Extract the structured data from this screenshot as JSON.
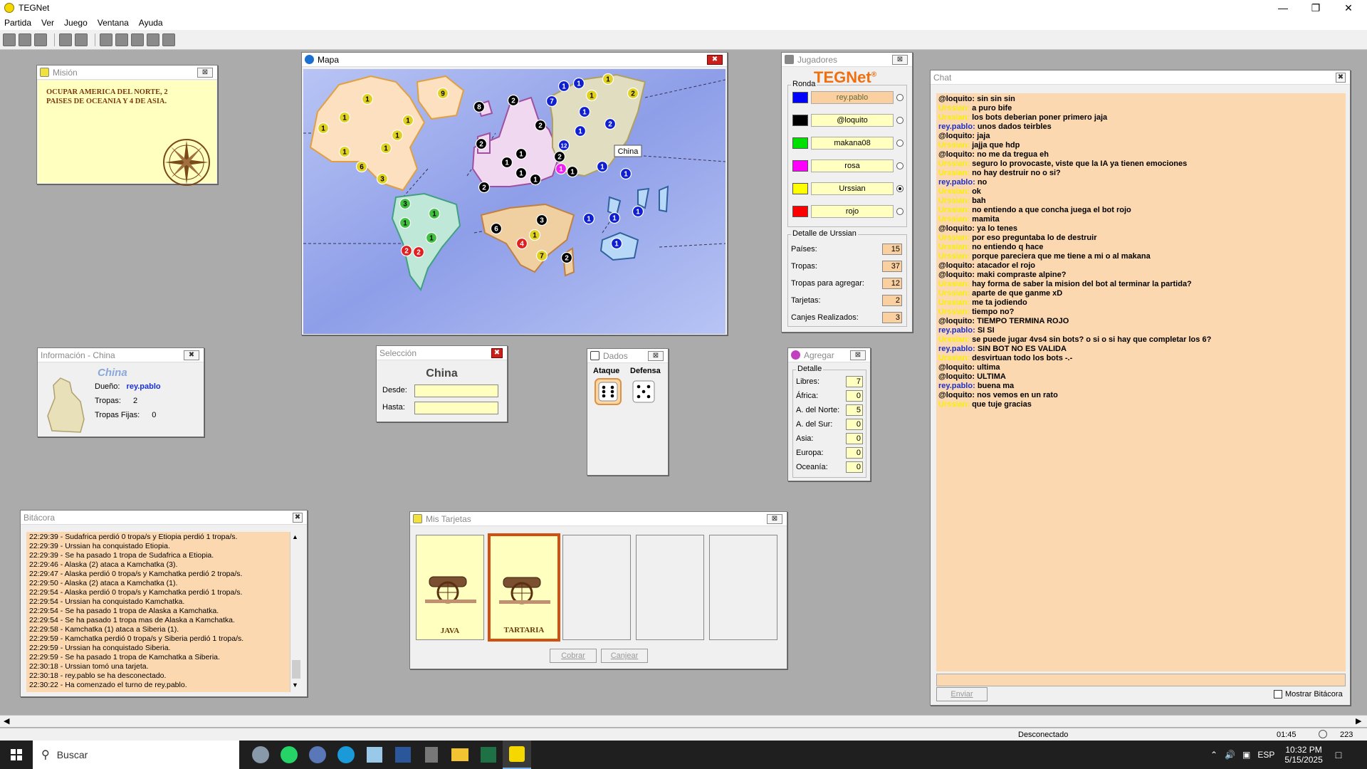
{
  "window": {
    "title": "TEGNet"
  },
  "menu": [
    "Partida",
    "Ver",
    "Juego",
    "Ventana",
    "Ayuda"
  ],
  "mision": {
    "title": "Misión",
    "text": "OCUPAR AMERICA DEL NORTE, 2 PAISES DE OCEANIA Y 4 DE ASIA."
  },
  "mapa": {
    "title": "Mapa",
    "tooltip": "China",
    "colors": {
      "ocean": "#a9b7f0",
      "north_america": "#fde0c0",
      "south_america": "#c0e8d8",
      "europe": "#f0d8f0",
      "asia": "#e0ddc0",
      "africa": "#f0cfa0",
      "oceania": "#b8d8f8"
    },
    "markers": [
      {
        "n": "1",
        "c": "yellow"
      },
      {
        "n": "1",
        "c": "yellow"
      },
      {
        "n": "1",
        "c": "yellow"
      },
      {
        "n": "1",
        "c": "yellow"
      },
      {
        "n": "1",
        "c": "yellow"
      },
      {
        "n": "1",
        "c": "yellow"
      },
      {
        "n": "1",
        "c": "yellow"
      },
      {
        "n": "6",
        "c": "yellow"
      },
      {
        "n": "3",
        "c": "yellow"
      },
      {
        "n": "9",
        "c": "yellow"
      },
      {
        "n": "3",
        "c": "green"
      },
      {
        "n": "1",
        "c": "green"
      },
      {
        "n": "1",
        "c": "green"
      },
      {
        "n": "1",
        "c": "green"
      },
      {
        "n": "2",
        "c": "red"
      },
      {
        "n": "2",
        "c": "red"
      },
      {
        "n": "8",
        "c": "black"
      },
      {
        "n": "2",
        "c": "black"
      },
      {
        "n": "2",
        "c": "black"
      },
      {
        "n": "2",
        "c": "black"
      },
      {
        "n": "1",
        "c": "black"
      },
      {
        "n": "1",
        "c": "black"
      },
      {
        "n": "1",
        "c": "black"
      },
      {
        "n": "1",
        "c": "black"
      },
      {
        "n": "2",
        "c": "black"
      },
      {
        "n": "2",
        "c": "black"
      },
      {
        "n": "1",
        "c": "black"
      },
      {
        "n": "1",
        "c": "magenta"
      },
      {
        "n": "6",
        "c": "black"
      },
      {
        "n": "3",
        "c": "black"
      },
      {
        "n": "4",
        "c": "red"
      },
      {
        "n": "1",
        "c": "yellow"
      },
      {
        "n": "7",
        "c": "yellow"
      },
      {
        "n": "2",
        "c": "black"
      },
      {
        "n": "1",
        "c": "blue"
      },
      {
        "n": "1",
        "c": "blue"
      },
      {
        "n": "7",
        "c": "blue"
      },
      {
        "n": "1",
        "c": "yellow"
      },
      {
        "n": "1",
        "c": "yellow"
      },
      {
        "n": "1",
        "c": "blue"
      },
      {
        "n": "2",
        "c": "yellow"
      },
      {
        "n": "2",
        "c": "blue"
      },
      {
        "n": "1",
        "c": "blue"
      },
      {
        "n": "12",
        "c": "blue"
      },
      {
        "n": "1",
        "c": "blue"
      },
      {
        "n": "1",
        "c": "blue"
      },
      {
        "n": "1",
        "c": "blue"
      },
      {
        "n": "1",
        "c": "blue"
      },
      {
        "n": "1",
        "c": "blue"
      },
      {
        "n": "1",
        "c": "blue"
      }
    ]
  },
  "jugadores": {
    "title": "Jugadores",
    "logo": "TEGNet",
    "logo_mark": "®",
    "ronda_label": "Ronda",
    "players": [
      {
        "name": "rey.pablo",
        "color": "#0000ff",
        "active": false,
        "highlight": true
      },
      {
        "name": "@loquito",
        "color": "#000000",
        "active": false,
        "highlight": false
      },
      {
        "name": "makana08",
        "color": "#00e000",
        "active": false,
        "highlight": false
      },
      {
        "name": "rosa",
        "color": "#ff00ff",
        "active": false,
        "highlight": false
      },
      {
        "name": "Urssian",
        "color": "#ffff00",
        "active": true,
        "highlight": false
      },
      {
        "name": "rojo",
        "color": "#ff0000",
        "active": false,
        "highlight": false
      }
    ],
    "detalle_title": "Detalle de Urssian",
    "detalle": [
      {
        "label": "Países:",
        "value": "15"
      },
      {
        "label": "Tropas:",
        "value": "37"
      },
      {
        "label": "Tropas para agregar:",
        "value": "12"
      },
      {
        "label": "Tarjetas:",
        "value": "2"
      },
      {
        "label": "Canjes Realizados:",
        "value": "3"
      }
    ]
  },
  "info": {
    "title": "Información - China",
    "country": "China",
    "dueno_label": "Dueño:",
    "dueno": "rey.pablo",
    "tropas_label": "Tropas:",
    "tropas": "2",
    "fijas_label": "Tropas Fijas:",
    "fijas": "0"
  },
  "seleccion": {
    "title": "Selección",
    "country": "China",
    "desde_label": "Desde:",
    "hasta_label": "Hasta:"
  },
  "dados": {
    "title": "Dados",
    "ataque": "Ataque",
    "defensa": "Defensa"
  },
  "agregar": {
    "title": "Agregar",
    "detalle_label": "Detalle",
    "rows": [
      {
        "label": "Libres:",
        "value": "7"
      },
      {
        "label": "África:",
        "value": "0"
      },
      {
        "label": "A. del Norte:",
        "value": "5"
      },
      {
        "label": "A. del Sur:",
        "value": "0"
      },
      {
        "label": "Asia:",
        "value": "0"
      },
      {
        "label": "Europa:",
        "value": "0"
      },
      {
        "label": "Oceanía:",
        "value": "0"
      }
    ]
  },
  "bitacora": {
    "title": "Bitácora",
    "lines": [
      "22:29:39 - Sudafrica perdió 0 tropa/s y Etiopia perdió 1 tropa/s.",
      "22:29:39 - Urssian ha conquistado Etiopia.",
      "22:29:39 - Se ha pasado 1 tropa de Sudafrica a Etiopia.",
      "22:29:46 - Alaska (2) ataca a Kamchatka (3).",
      "22:29:47 - Alaska perdió 0 tropa/s y Kamchatka perdió 2 tropa/s.",
      "22:29:50 - Alaska (2) ataca a Kamchatka (1).",
      "22:29:54 - Alaska perdió 0 tropa/s y Kamchatka perdió 1 tropa/s.",
      "22:29:54 - Urssian ha conquistado Kamchatka.",
      "22:29:54 - Se ha pasado 1 tropa de Alaska a Kamchatka.",
      "22:29:54 - Se ha pasado 1 tropa mas de Alaska a Kamchatka.",
      "22:29:58 - Kamchatka (1) ataca a Siberia (1).",
      "22:29:59 - Kamchatka perdió 0 tropa/s y Siberia perdió 1 tropa/s.",
      "22:29:59 - Urssian ha conquistado Siberia.",
      "22:29:59 - Se ha pasado 1 tropa de Kamchatka a Siberia.",
      "22:30:18 - Urssian tomó una tarjeta.",
      "22:30:18 - rey.pablo se ha desconectado.",
      "22:30:22 - Ha comenzado el turno de rey.pablo."
    ]
  },
  "tarjetas": {
    "title": "Mis Tarjetas",
    "cards": [
      {
        "name": "JAVA",
        "selected": false,
        "filled": true
      },
      {
        "name": "TARTARIA",
        "selected": true,
        "filled": true
      },
      {
        "name": "",
        "selected": false,
        "filled": false
      },
      {
        "name": "",
        "selected": false,
        "filled": false
      },
      {
        "name": "",
        "selected": false,
        "filled": false
      }
    ],
    "cobrar": "Cobrar",
    "canjear": "Canjear"
  },
  "chat": {
    "title": "Chat",
    "send": "Enviar",
    "show_log": "Mostrar Bitácora",
    "messages": [
      {
        "user": "@loquito:",
        "text": "sin sin sin",
        "kind": "black"
      },
      {
        "user": "Urssian:",
        "text": "a puro bife",
        "kind": "yellow"
      },
      {
        "user": "Urssian:",
        "text": "los bots deberian poner primero jaja",
        "kind": "yellow"
      },
      {
        "user": "rey.pablo:",
        "text": "unos dados teirbles",
        "kind": "blue"
      },
      {
        "user": "@loquito:",
        "text": "jaja",
        "kind": "black"
      },
      {
        "user": "Urssian:",
        "text": "jajja que hdp",
        "kind": "yellow"
      },
      {
        "user": "@loquito:",
        "text": "no me da tregua eh",
        "kind": "black"
      },
      {
        "user": "Urssian:",
        "text": "seguro lo provocaste, viste que la IA ya tienen emociones",
        "kind": "yellow"
      },
      {
        "user": "Urssian:",
        "text": "no hay destruir no o si?",
        "kind": "yellow"
      },
      {
        "user": "rey.pablo:",
        "text": "no",
        "kind": "blue"
      },
      {
        "user": "Urssian:",
        "text": "ok",
        "kind": "yellow"
      },
      {
        "user": "Urssian:",
        "text": "bah",
        "kind": "yellow"
      },
      {
        "user": "Urssian:",
        "text": "no entiendo a que concha juega el bot rojo",
        "kind": "yellow"
      },
      {
        "user": "Urssian:",
        "text": "mamita",
        "kind": "yellow"
      },
      {
        "user": "@loquito:",
        "text": "ya lo tenes",
        "kind": "black"
      },
      {
        "user": "Urssian:",
        "text": "por eso preguntaba lo de destruir",
        "kind": "yellow"
      },
      {
        "user": "Urssian:",
        "text": "no entiendo q hace",
        "kind": "yellow"
      },
      {
        "user": "Urssian:",
        "text": "porque pareciera que me tiene a mi o al makana",
        "kind": "yellow"
      },
      {
        "user": "@loquito:",
        "text": "atacador el rojo",
        "kind": "black"
      },
      {
        "user": "@loquito:",
        "text": "maki compraste alpine?",
        "kind": "black"
      },
      {
        "user": "Urssian:",
        "text": "hay forma de saber la mision del bot al terminar la partida?",
        "kind": "yellow"
      },
      {
        "user": "Urssian:",
        "text": "aparte de que ganme xD",
        "kind": "yellow"
      },
      {
        "user": "Urssian:",
        "text": "me ta jodiendo",
        "kind": "yellow"
      },
      {
        "user": "Urssian:",
        "text": "tiempo no?",
        "kind": "yellow"
      },
      {
        "user": "@loquito:",
        "text": "TIEMPO TERMINA ROJO",
        "kind": "black"
      },
      {
        "user": "rey.pablo:",
        "text": "SI SI",
        "kind": "blue"
      },
      {
        "user": "Urssian:",
        "text": "se puede jugar 4vs4 sin bots? o si o si hay que completar los 6?",
        "kind": "yellow"
      },
      {
        "user": "rey.pablo:",
        "text": "SIN BOT  NO ES VALIDA",
        "kind": "blue"
      },
      {
        "user": "Urssian:",
        "text": "desvirtuan todo los bots -.-",
        "kind": "yellow"
      },
      {
        "user": "@loquito:",
        "text": "ultima",
        "kind": "black"
      },
      {
        "user": "@loquito:",
        "text": "ULTIMA",
        "kind": "black"
      },
      {
        "user": "rey.pablo:",
        "text": "buena ma",
        "kind": "blue"
      },
      {
        "user": "@loquito:",
        "text": "nos vemos en un rato",
        "kind": "black"
      },
      {
        "user": "Urssian:",
        "text": "que tuje gracias",
        "kind": "yellow"
      }
    ]
  },
  "status": {
    "connection": "Desconectado",
    "timer": "01:45",
    "count": "223"
  },
  "taskbar": {
    "search": "Buscar",
    "lang": "ESP",
    "time": "10:32 PM",
    "date": "5/15/2025"
  }
}
